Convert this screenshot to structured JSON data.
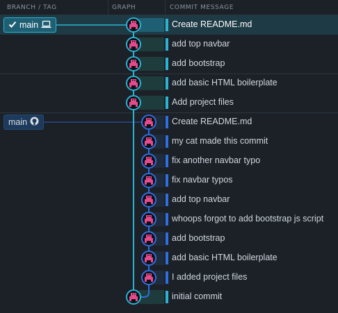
{
  "header": {
    "branch_tag": "BRANCH / TAG",
    "graph": "GRAPH",
    "commit_message": "COMMIT MESSAGE"
  },
  "colors": {
    "local_lane": "#2bb3d1",
    "remote_lane": "#2f6fe0",
    "avatar": "#e64a8c",
    "selected_row": "#1e3a45"
  },
  "branches": {
    "local": {
      "label": "main",
      "checked_icon": "checkmark-icon",
      "icon": "laptop-icon"
    },
    "remote": {
      "label": "main",
      "icon": "github-icon"
    }
  },
  "commits": [
    {
      "message": "Create README.md",
      "lane": "local",
      "selected": true
    },
    {
      "message": "add top navbar",
      "lane": "local"
    },
    {
      "message": "add bootstrap",
      "lane": "local"
    },
    {
      "message": "add basic HTML boilerplate",
      "lane": "local"
    },
    {
      "message": "Add project files",
      "lane": "local"
    },
    {
      "message": "Create README.md",
      "lane": "remote"
    },
    {
      "message": "my cat made this commit",
      "lane": "remote"
    },
    {
      "message": "fix another navbar typo",
      "lane": "remote"
    },
    {
      "message": "fix navbar typos",
      "lane": "remote"
    },
    {
      "message": "add top navbar",
      "lane": "remote"
    },
    {
      "message": "whoops forgot to add bootstrap js script",
      "lane": "remote"
    },
    {
      "message": "add bootstrap",
      "lane": "remote"
    },
    {
      "message": "add basic HTML boilerplate",
      "lane": "remote"
    },
    {
      "message": "I added project files",
      "lane": "remote"
    },
    {
      "message": "initial commit",
      "lane": "local"
    }
  ]
}
